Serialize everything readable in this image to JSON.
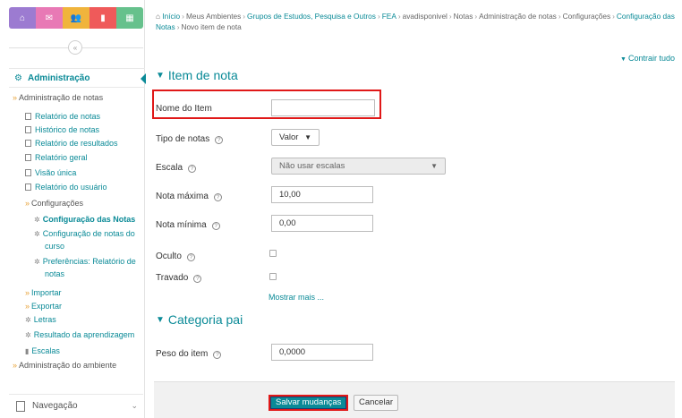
{
  "colors": {
    "accent": "#0a8a97",
    "highlight": "#e01818",
    "chevron": "#e8a33a"
  },
  "topbar": {
    "buttons": [
      {
        "icon": "home-icon",
        "glyph": "⌂",
        "color": "#9c7bd1"
      },
      {
        "icon": "mail-icon",
        "glyph": "✉",
        "color": "#e879b5"
      },
      {
        "icon": "users-icon",
        "glyph": "👥",
        "color": "#f0b43c"
      },
      {
        "icon": "page-icon",
        "glyph": "▮",
        "color": "#ef5a5a"
      },
      {
        "icon": "grid-icon",
        "glyph": "▦",
        "color": "#66c18c"
      }
    ]
  },
  "sidebar": {
    "collapse_glyph": "«",
    "admin_title": "Administração",
    "tree": [
      {
        "label": "Administração de notas",
        "kind": "cat",
        "marker": "»"
      },
      {
        "label": "Relatório de notas",
        "kind": "lnk",
        "marker": "doc"
      },
      {
        "label": "Histórico de notas",
        "kind": "lnk",
        "marker": "doc"
      },
      {
        "label": "Relatório de resultados",
        "kind": "lnk",
        "marker": "doc"
      },
      {
        "label": "Relatório geral",
        "kind": "lnk",
        "marker": "doc"
      },
      {
        "label": "Visão única",
        "kind": "lnk",
        "marker": "doc"
      },
      {
        "label": "Relatório do usuário",
        "kind": "lnk",
        "marker": "doc"
      },
      {
        "label": "Configurações",
        "kind": "cat",
        "marker": "»"
      },
      {
        "label": "Configuração das Notas",
        "kind": "lnk",
        "marker": "dot",
        "bold": true
      },
      {
        "label": "Configuração de notas do",
        "kind": "lnk",
        "marker": "dot"
      },
      {
        "label": "curso",
        "kind": "lnk",
        "marker": ""
      },
      {
        "label": "Preferências: Relatório de",
        "kind": "lnk",
        "marker": "dot"
      },
      {
        "label": "notas",
        "kind": "lnk",
        "marker": ""
      },
      {
        "label": "Importar",
        "kind": "lnk",
        "marker": "»"
      },
      {
        "label": "Exportar",
        "kind": "lnk",
        "marker": "»"
      },
      {
        "label": "Letras",
        "kind": "lnk",
        "marker": "dot"
      },
      {
        "label": "Resultado da aprendizagem",
        "kind": "lnk",
        "marker": "dot"
      },
      {
        "label": "Escalas",
        "kind": "lnk",
        "marker": "bars"
      },
      {
        "label": "Administração do ambiente",
        "kind": "cat",
        "marker": "»"
      }
    ],
    "nav_title": "Navegação"
  },
  "breadcrumb": {
    "items": [
      {
        "text": "Início",
        "link": true
      },
      {
        "text": "Meus Ambientes",
        "link": false
      },
      {
        "text": "Grupos de Estudos, Pesquisa e Outros",
        "link": true
      },
      {
        "text": "FEA",
        "link": true
      },
      {
        "text": "avadisponivel",
        "link": false
      },
      {
        "text": "Notas",
        "link": false
      },
      {
        "text": "Administração de notas",
        "link": false
      },
      {
        "text": "Configurações",
        "link": false
      },
      {
        "text": "Configuração das Notas",
        "link": true
      },
      {
        "text": "Novo item de nota",
        "link": false
      }
    ],
    "separator": "›"
  },
  "expand_all": "Contrair tudo",
  "form": {
    "section1": "Item de nota",
    "name_label": "Nome do Item",
    "name_value": "",
    "gradetype_label": "Tipo de notas",
    "gradetype_value": "Valor",
    "scale_label": "Escala",
    "scale_value": "Não usar escalas",
    "max_label": "Nota máxima",
    "max_value": "10,00",
    "min_label": "Nota mínima",
    "min_value": "0,00",
    "hidden_label": "Oculto",
    "locked_label": "Travado",
    "show_more": "Mostrar mais ...",
    "section2": "Categoria pai",
    "weight_label": "Peso do item",
    "weight_value": "0,0000",
    "help_glyph": "?"
  },
  "actions": {
    "save": "Salvar mudanças",
    "cancel": "Cancelar"
  }
}
